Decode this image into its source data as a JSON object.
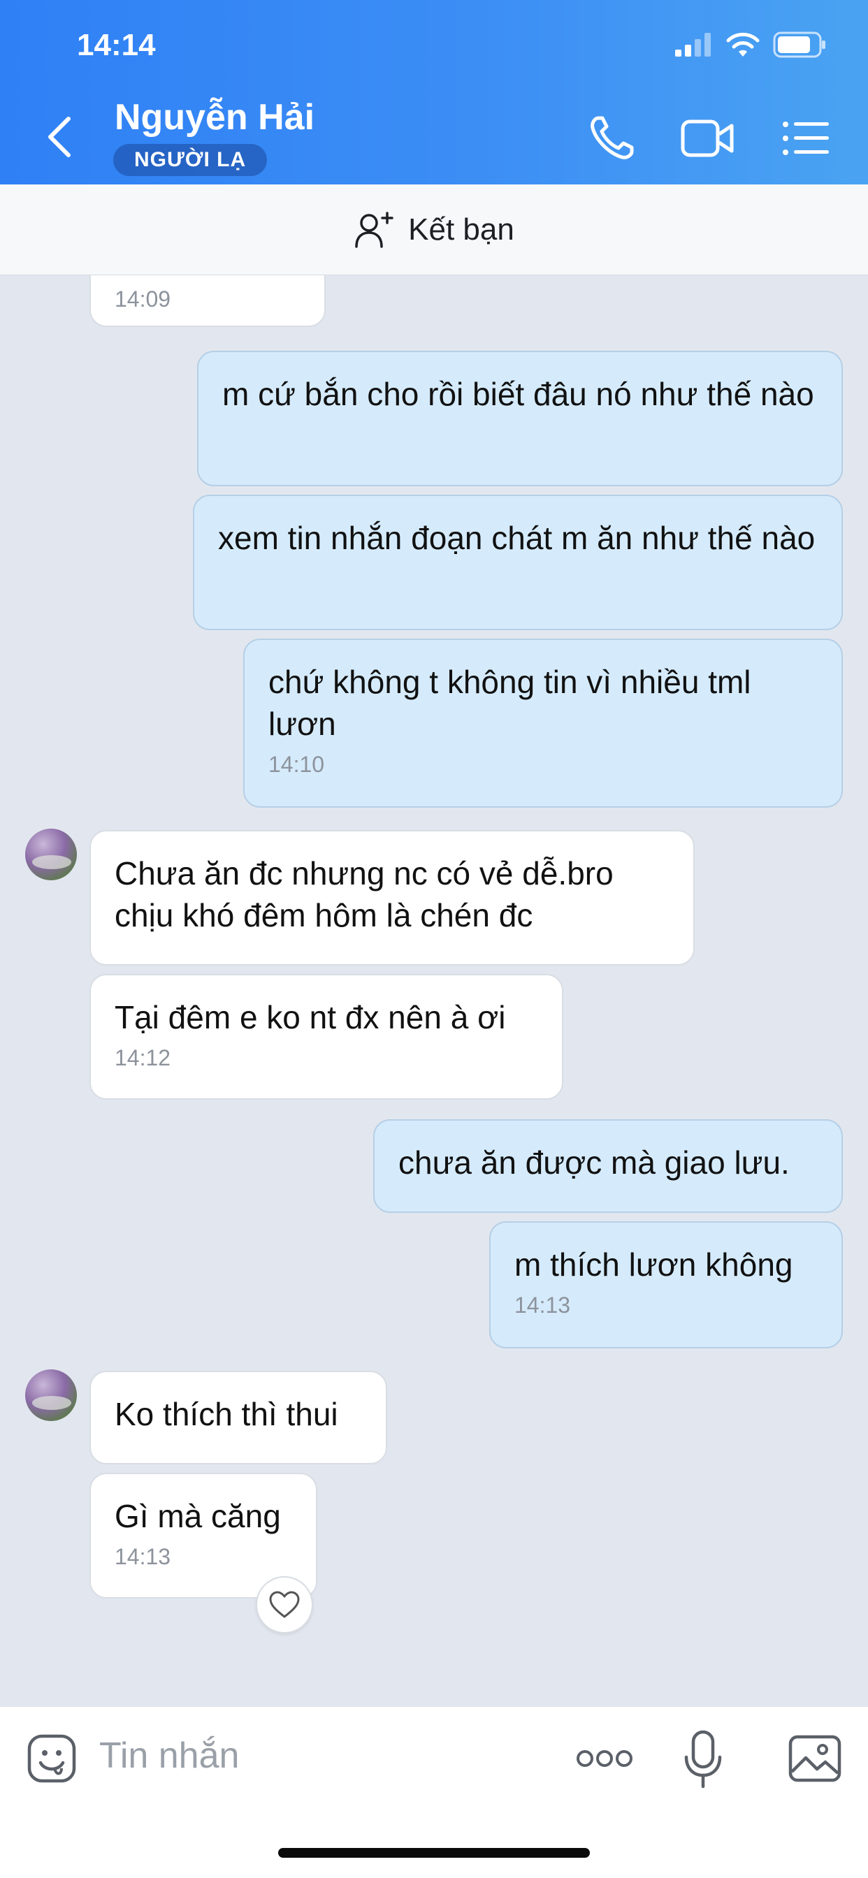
{
  "status_bar": {
    "time": "14:14"
  },
  "header": {
    "contact_name": "Nguyễn Hải",
    "badge": "NGƯỜI LẠ"
  },
  "add_friend": {
    "label": "Kết bạn"
  },
  "messages": [
    {
      "dir": "in",
      "timestamp": "14:09"
    },
    {
      "dir": "out",
      "text": "m cứ bắn cho rồi biết đâu nó như thế nào"
    },
    {
      "dir": "out",
      "text": "xem tin nhắn đoạn chát m ăn như thế nào"
    },
    {
      "dir": "out",
      "text": "chứ không t không tin vì nhiều tml lươn",
      "timestamp": "14:10"
    },
    {
      "dir": "in",
      "text": "Chưa ăn đc nhưng nc có vẻ dễ.bro chịu khó đêm hôm là chén đc"
    },
    {
      "dir": "in",
      "text": "Tại đêm e ko nt đx nên à ơi",
      "timestamp": "14:12"
    },
    {
      "dir": "out",
      "text": "chưa ăn được mà giao lưu."
    },
    {
      "dir": "out",
      "text": "m thích lươn không",
      "timestamp": "14:13"
    },
    {
      "dir": "in",
      "text": "Ko thích thì thui"
    },
    {
      "dir": "in",
      "text": "Gì mà căng",
      "timestamp": "14:13"
    }
  ],
  "input": {
    "placeholder": "Tin nhắn"
  },
  "colors": {
    "header_start": "#2f80f5",
    "header_end": "#4aa3f2",
    "chat_bg": "#e2e7ef",
    "incoming_bubble": "#ffffff",
    "outgoing_bubble": "#d5ebfc"
  },
  "icons": [
    "back-icon",
    "phone-icon",
    "video-call-icon",
    "menu-list-icon",
    "add-friend-icon",
    "sticker-icon",
    "more-icon",
    "microphone-icon",
    "image-icon",
    "heart-icon"
  ]
}
